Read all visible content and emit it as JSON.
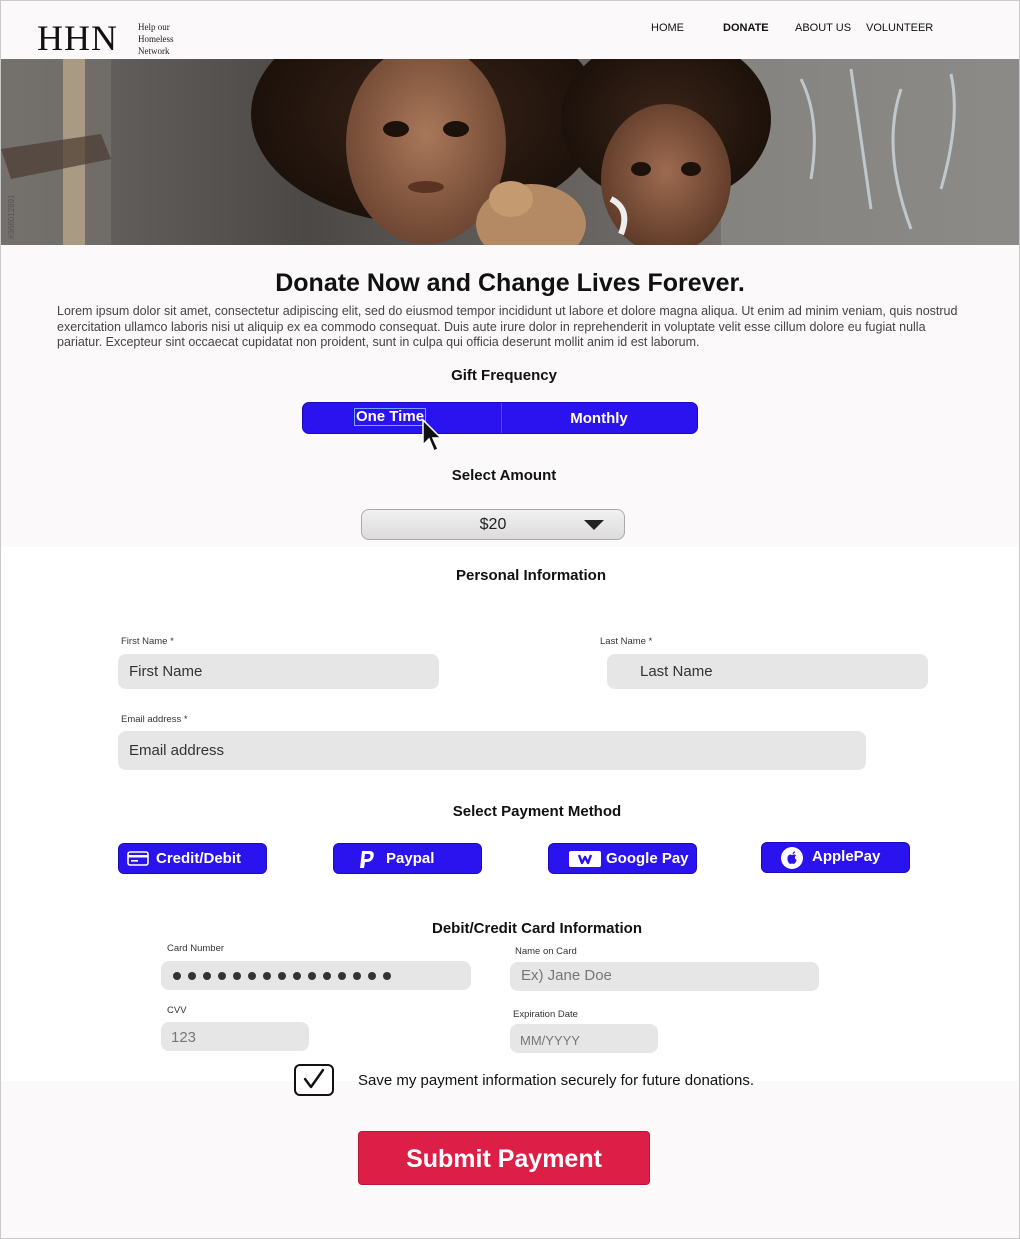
{
  "header": {
    "logo": "HHN",
    "tagline": [
      "Help our",
      "Homeless",
      "Network"
    ],
    "nav": [
      {
        "label": "HOME",
        "active": false
      },
      {
        "label": "DONATE",
        "active": true
      },
      {
        "label": "ABOUT US",
        "active": false
      },
      {
        "label": "VOLUNTEER",
        "active": false
      }
    ]
  },
  "hero": {
    "watermark": "#368012891"
  },
  "main": {
    "title": "Donate Now and Change Lives Forever.",
    "intro": "Lorem ipsum dolor sit amet, consectetur adipiscing elit, sed do eiusmod tempor incididunt ut labore et dolore magna aliqua. Ut enim ad minim veniam, quis nostrud exercitation ullamco laboris nisi ut aliquip ex ea commodo consequat. Duis aute irure dolor in reprehenderit in voluptate velit esse cillum dolore eu fugiat nulla pariatur. Excepteur sint occaecat cupidatat non proident, sunt in culpa qui officia deserunt mollit anim id est laborum."
  },
  "frequency": {
    "title": "Gift Frequency",
    "options": [
      "One Time",
      "Monthly"
    ],
    "selected": "One Time"
  },
  "amount": {
    "title": "Select Amount",
    "value": "$20"
  },
  "personal": {
    "title": "Personal Information",
    "first_name": {
      "label": "First Name *",
      "placeholder": "First Name"
    },
    "last_name": {
      "label": "Last Name *",
      "placeholder": "Last Name"
    },
    "email": {
      "label": "Email address *",
      "placeholder": "Email address"
    }
  },
  "payment": {
    "title": "Select Payment Method",
    "methods": [
      {
        "label": "Credit/Debit",
        "icon": "credit-card-icon"
      },
      {
        "label": "Paypal",
        "icon": "paypal-icon"
      },
      {
        "label": "Google Pay",
        "icon": "wallet-icon"
      },
      {
        "label": "ApplePay",
        "icon": "apple-icon"
      }
    ],
    "accent_color": "#2a13ee"
  },
  "card": {
    "title": "Debit/Credit Card Information",
    "number": {
      "label": "Card Number",
      "masked_count": 15
    },
    "name": {
      "label": "Name on Card",
      "placeholder": "Ex) Jane Doe"
    },
    "cvv": {
      "label": "CVV",
      "placeholder": "123"
    },
    "expiry": {
      "label": "Expiration Date",
      "placeholder": "MM/YYYY"
    }
  },
  "save": {
    "label": "Save my payment information securely for future donations.",
    "checked": true
  },
  "submit": {
    "label": "Submit Payment",
    "color": "#dd1f47"
  }
}
